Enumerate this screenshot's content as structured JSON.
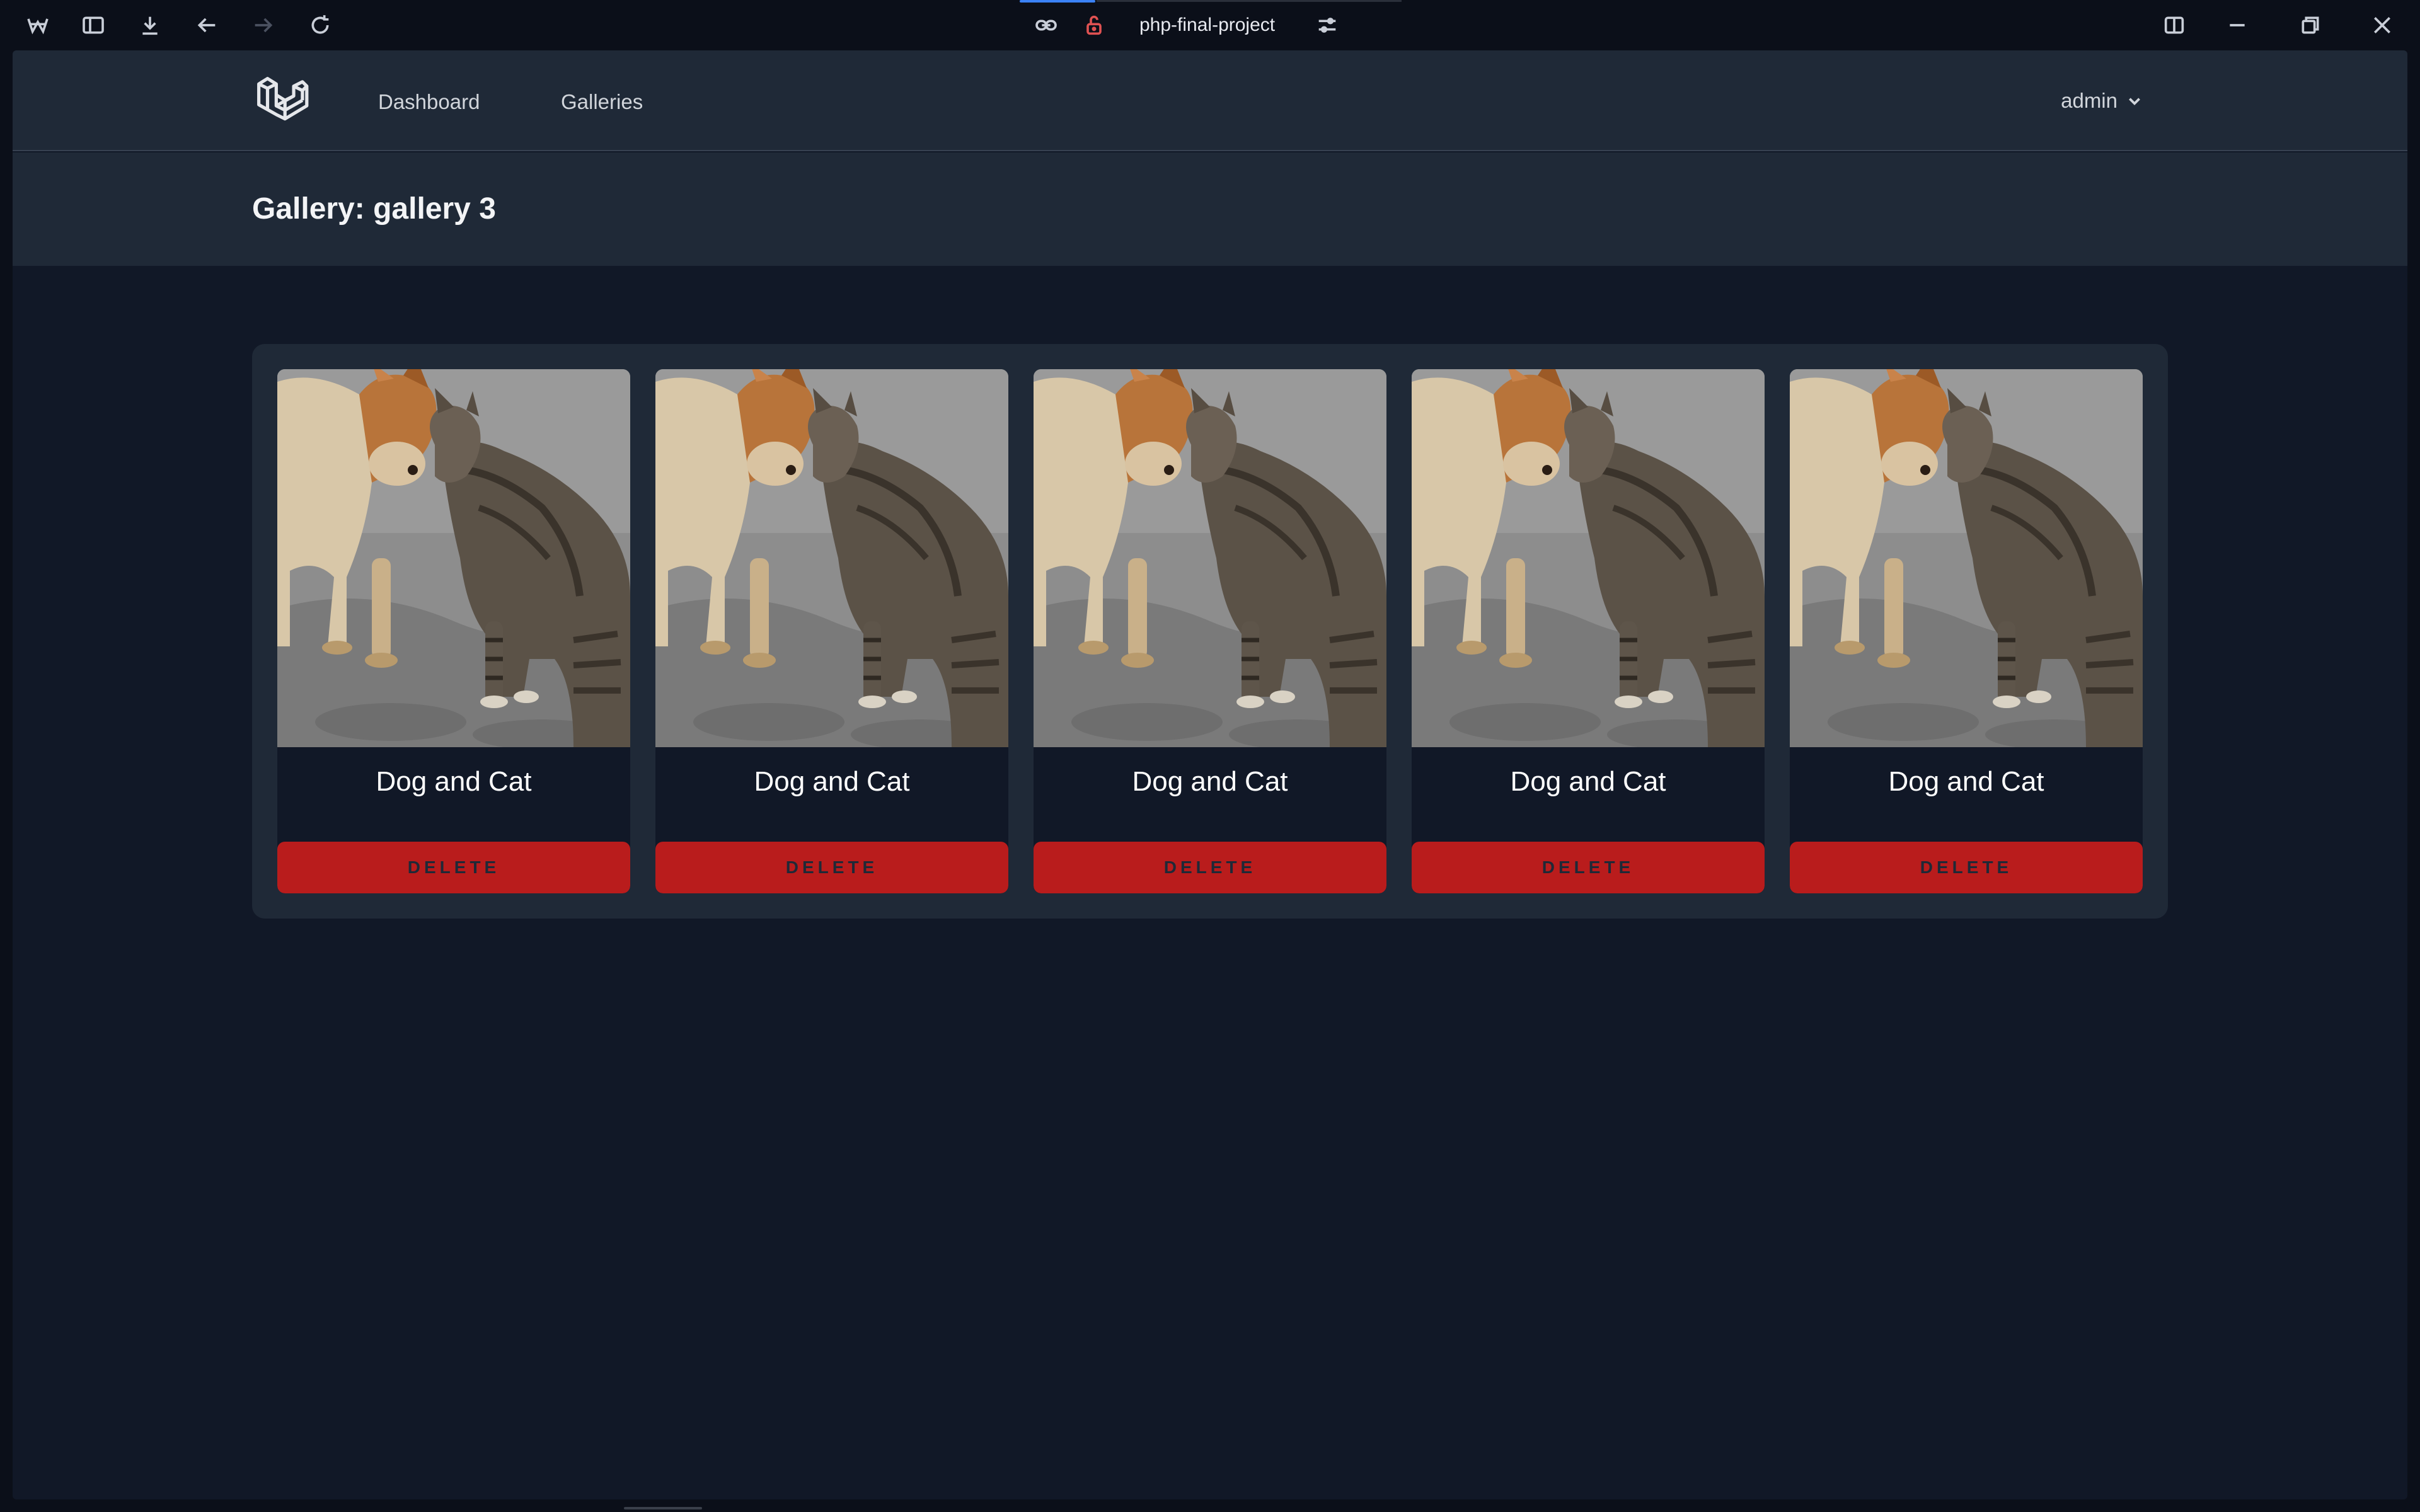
{
  "browser": {
    "tab_title": "php-final-project",
    "toolbar_icons": [
      "app-logo-icon",
      "sidebar-toggle-icon",
      "download-icon",
      "back-icon",
      "forward-icon",
      "reload-icon",
      "link-icon",
      "lock-open-icon",
      "site-settings-icon",
      "split-view-icon",
      "minimize-icon",
      "restore-icon",
      "close-icon"
    ]
  },
  "nav": {
    "links": [
      {
        "label": "Dashboard"
      },
      {
        "label": "Galleries"
      }
    ],
    "user": {
      "name": "admin"
    }
  },
  "header": {
    "title": "Gallery: gallery 3"
  },
  "gallery": {
    "items": [
      {
        "title": "Dog and Cat",
        "action": "DELETE"
      },
      {
        "title": "Dog and Cat",
        "action": "DELETE"
      },
      {
        "title": "Dog and Cat",
        "action": "DELETE"
      },
      {
        "title": "Dog and Cat",
        "action": "DELETE"
      },
      {
        "title": "Dog and Cat",
        "action": "DELETE"
      }
    ]
  },
  "colors": {
    "nav_bg": "#1f2937",
    "page_bg": "#111827",
    "delete_bg": "#b91c1c",
    "accent": "#3b82f6"
  }
}
